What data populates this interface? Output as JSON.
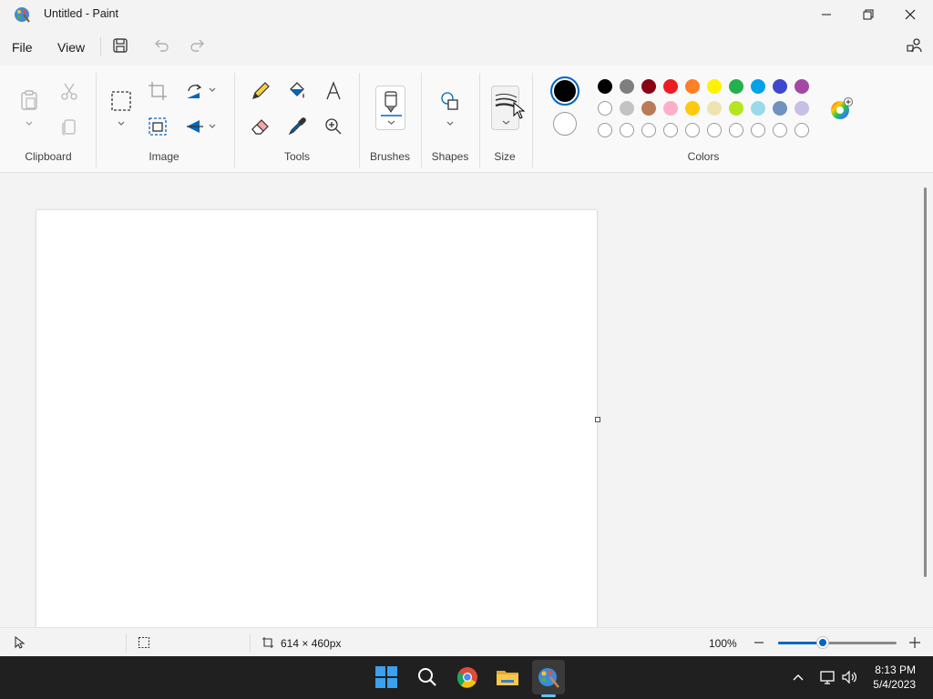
{
  "window": {
    "title": "Untitled - Paint",
    "controls": [
      "minimize-icon",
      "maximize-icon",
      "close-icon"
    ]
  },
  "menu": {
    "file": "File",
    "view": "View"
  },
  "quick_access": [
    "save-icon",
    "undo-icon",
    "redo-icon"
  ],
  "ribbon": {
    "groups": {
      "clipboard": "Clipboard",
      "image": "Image",
      "tools": "Tools",
      "brushes": "Brushes",
      "shapes": "Shapes",
      "size": "Size",
      "colors": "Colors"
    },
    "primary_color": "#000000",
    "secondary_color": "#ffffff",
    "palette_row1": [
      "#000000",
      "#7f7f7f",
      "#880015",
      "#ed1c24",
      "#ff7f27",
      "#fff200",
      "#22b14c",
      "#00a2e8",
      "#3f48cc",
      "#a349a4"
    ],
    "palette_row2": [
      "#ffffff",
      "#c3c3c3",
      "#b97a57",
      "#ffaec9",
      "#ffc90e",
      "#efe4b0",
      "#b5e61d",
      "#99d9ea",
      "#7092be",
      "#c8bfe7"
    ]
  },
  "status": {
    "canvas_size": "614 × 460px",
    "zoom": "100%",
    "zoom_fraction": 0.38
  },
  "taskbar": {
    "time": "8:13 PM",
    "date": "5/4/2023"
  },
  "colors": {
    "accent": "#0067c0",
    "taskbar": "#202020"
  }
}
